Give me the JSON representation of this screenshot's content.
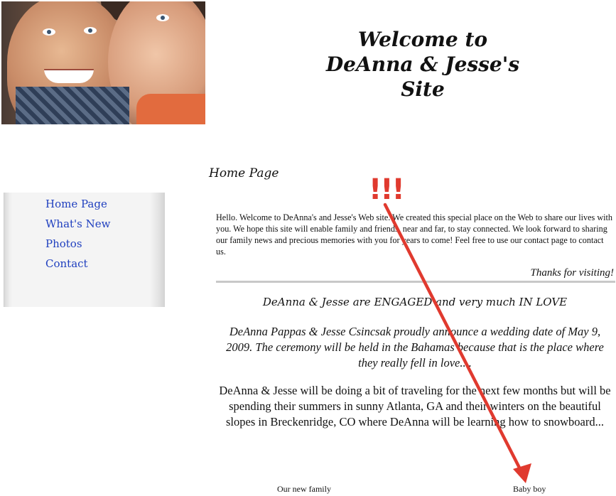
{
  "header": {
    "title_line1": "Welcome to",
    "title_line2": "DeAnna & Jesse's Site",
    "photo_icon": "couple-photo"
  },
  "sidebar": {
    "items": [
      {
        "label": "Home Page"
      },
      {
        "label": "What's New"
      },
      {
        "label": "Photos"
      },
      {
        "label": "Contact"
      }
    ]
  },
  "main": {
    "heading": "Home Page",
    "intro": "Hello. Welcome to DeAnna's and Jesse's Web site. We created this special place on the Web to share our lives with you. We hope this site will enable family and friends, near and far, to stay connected. We look forward to sharing our family news and precious memories with you for years to come! Feel free to use our contact page to contact us.",
    "thanks": "Thanks for visiting!",
    "engaged": "DeAnna & Jesse are ENGAGED and very much IN LOVE",
    "announcement": "DeAnna Pappas & Jesse Csincsak proudly announce a wedding date of May 9, 2009.  The ceremony will be held in the Bahamas because that is the place where they really fell in love....",
    "travel": "DeAnna & Jesse will be doing a bit of traveling for the next few months but will be spending their summers in sunny Atlanta, GA and their winters on the beautiful slopes in Breckenridge, CO where DeAnna  will be learning how to snowboard...",
    "captions": {
      "family": "Our new family",
      "baby": "Baby boy"
    }
  },
  "annotation": {
    "exclamation": "!!!",
    "color": "#e03a2f",
    "arrow_icon": "red-arrow"
  },
  "colors": {
    "link": "#1f3fbf",
    "divider": "#c8c8c8",
    "annotation": "#e03a2f"
  }
}
